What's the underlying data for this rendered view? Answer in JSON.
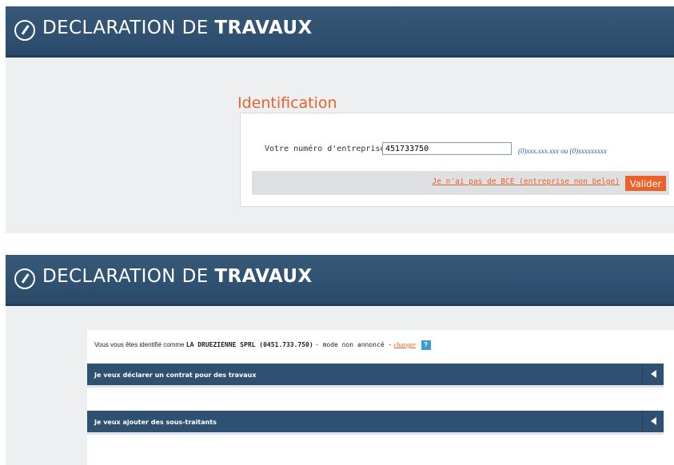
{
  "header": {
    "title_light": "DECLARATION DE",
    "title_bold": "TRAVAUX",
    "logo_icon": "circle-slash-icon"
  },
  "identification": {
    "heading": "Identification",
    "field_label": "Votre numéro d'entreprise",
    "field_value": "451733750",
    "field_hint": "(0)xxx.xxx.xxx ou (0)xxxxxxxxx",
    "no_bce_link": "Je n'ai pas de BCE (entreprise non belge)",
    "submit_label": "Valider"
  },
  "dashboard": {
    "ident_prefix": "Vous vous êtes identifié comme",
    "company": "LA DRUEZIENNE SPRL (0451.733.750)",
    "mode": "- mode non annoncé -",
    "change_link": "changer",
    "help_label": "?",
    "sections": [
      {
        "label": "Je veux déclarer un contrat pour des travaux"
      },
      {
        "label": "Je veux ajouter des sous-traitants"
      }
    ]
  },
  "colors": {
    "header_blue": "#2f5070",
    "accent_orange": "#e9622a",
    "help_blue": "#3d9ad6"
  }
}
